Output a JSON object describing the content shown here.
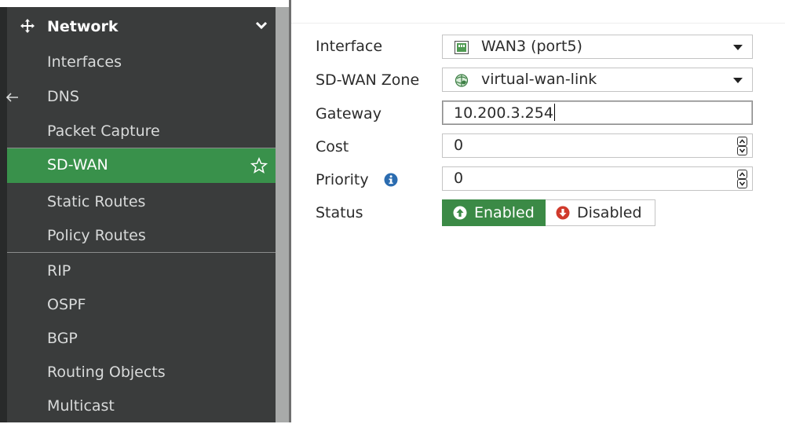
{
  "sidebar": {
    "header_label": "Network",
    "items": [
      {
        "label": "Interfaces",
        "active": false
      },
      {
        "label": "DNS",
        "active": false
      },
      {
        "label": "Packet Capture",
        "active": false
      },
      {
        "label": "SD-WAN",
        "active": true
      },
      {
        "label": "Static Routes",
        "active": false
      },
      {
        "label": "Policy Routes",
        "active": false
      },
      {
        "label": "RIP",
        "active": false
      },
      {
        "label": "OSPF",
        "active": false
      },
      {
        "label": "BGP",
        "active": false
      },
      {
        "label": "Routing Objects",
        "active": false
      },
      {
        "label": "Multicast",
        "active": false
      }
    ]
  },
  "form": {
    "interface": {
      "label": "Interface",
      "value": "WAN3 (port5)",
      "icon": "port-icon"
    },
    "zone": {
      "label": "SD-WAN Zone",
      "value": "virtual-wan-link",
      "icon": "sdwan-zone-icon"
    },
    "gateway": {
      "label": "Gateway",
      "value": "10.200.3.254"
    },
    "cost": {
      "label": "Cost",
      "value": "0"
    },
    "priority": {
      "label": "Priority",
      "value": "0"
    },
    "status": {
      "label": "Status",
      "enabled_label": "Enabled",
      "disabled_label": "Disabled",
      "selected": "Enabled"
    }
  },
  "colors": {
    "sidebar_bg": "#3a3c3c",
    "active_green": "#39914b",
    "enabled_green": "#3b8a46",
    "disabled_red": "#d03a2c",
    "info_blue": "#2b6cb0"
  }
}
